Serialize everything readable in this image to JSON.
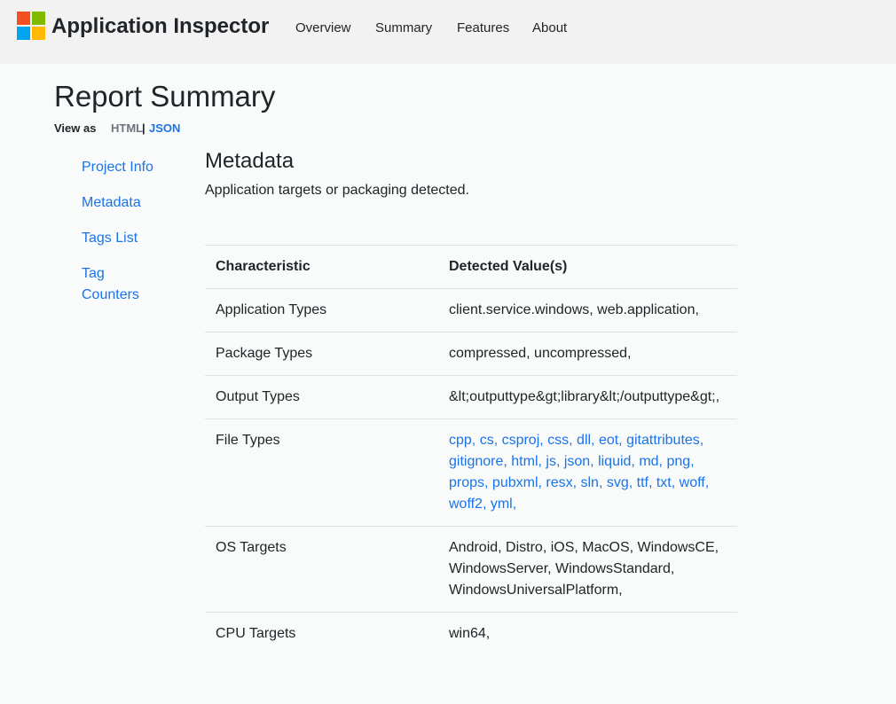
{
  "header": {
    "brand": "Application Inspector",
    "logo_colors": [
      "#f25022",
      "#7fba00",
      "#00a4ef",
      "#ffb900"
    ],
    "nav": [
      "Overview",
      "Summary",
      "Features",
      "About"
    ]
  },
  "page": {
    "title": "Report Summary",
    "view_as_label": "View as",
    "view_options": {
      "html": "HTML",
      "separator": "|",
      "json": "JSON"
    }
  },
  "sidebar": {
    "items": [
      "Project Info",
      "Metadata",
      "Tags List",
      "Tag Counters"
    ]
  },
  "metadata": {
    "title": "Metadata",
    "description": "Application targets or packaging detected.",
    "columns": [
      "Characteristic",
      "Detected Value(s)"
    ],
    "rows": [
      {
        "name": "Application Types",
        "value": "client.service.windows, web.application,"
      },
      {
        "name": "Package Types",
        "value": "compressed, uncompressed,"
      },
      {
        "name": "Output Types",
        "value": "&lt;outputtype&gt;library&lt;/outputtype&gt;,"
      },
      {
        "name": "File Types",
        "value": "cpp, cs, csproj, css, dll, eot, gitattributes, gitignore, html, js, json, liquid, md, png, props, pubxml, resx, sln, svg, ttf, txt, woff, woff2, yml,"
      },
      {
        "name": "OS Targets",
        "value": "Android, Distro, iOS, MacOS, WindowsCE, WindowsServer, WindowsStandard, WindowsUniversalPlatform,"
      },
      {
        "name": "CPU Targets",
        "value": "win64,"
      }
    ]
  },
  "colors": {
    "link": "#1a73e8",
    "header_bg": "#f2f2f2",
    "page_bg": "#f9fbfa"
  }
}
